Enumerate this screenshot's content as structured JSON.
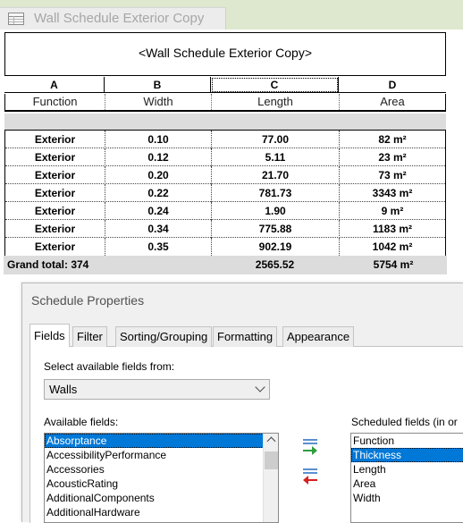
{
  "view_tab": {
    "title": "Wall Schedule Exterior Copy",
    "icon": "schedule-table-icon"
  },
  "schedule": {
    "title": "<Wall Schedule Exterior Copy>",
    "column_letters": [
      "A",
      "B",
      "C",
      "D"
    ],
    "headers": [
      "Function",
      "Width",
      "Length",
      "Area"
    ],
    "rows": [
      [
        "Exterior",
        "0.10",
        "77.00",
        "82 m²"
      ],
      [
        "Exterior",
        "0.12",
        "5.11",
        "23 m²"
      ],
      [
        "Exterior",
        "0.20",
        "21.70",
        "73 m²"
      ],
      [
        "Exterior",
        "0.22",
        "781.73",
        "3343 m²"
      ],
      [
        "Exterior",
        "0.24",
        "1.90",
        "9 m²"
      ],
      [
        "Exterior",
        "0.34",
        "775.88",
        "1183 m²"
      ],
      [
        "Exterior",
        "0.35",
        "902.19",
        "1042 m²"
      ]
    ],
    "grand_total": {
      "label": "Grand total: 374",
      "length": "2565.52",
      "area": "5754 m²"
    }
  },
  "dialog": {
    "title": "Schedule Properties",
    "tabs": [
      "Fields",
      "Filter",
      "Sorting/Grouping",
      "Formatting",
      "Appearance"
    ],
    "active_tab": "Fields",
    "select_label": "Select available fields from:",
    "select_value": "Walls",
    "available_label": "Available fields:",
    "available_fields": [
      "Absorptance",
      "AccessibilityPerformance",
      "Accessories",
      "AcousticRating",
      "AdditionalComponents",
      "AdditionalHardware"
    ],
    "available_selected": "Absorptance",
    "scheduled_label": "Scheduled fields (in or",
    "scheduled_fields": [
      "Function",
      "Thickness",
      "Length",
      "Area",
      "Width"
    ],
    "scheduled_selected": "Thickness",
    "add_icon": "add-field-arrow-icon",
    "remove_icon": "remove-field-arrow-icon"
  },
  "colors": {
    "selection": "#0078d7",
    "add_arrow": "#2e9e3e",
    "remove_arrow": "#d42020",
    "tab_strip": "#dde8ce"
  }
}
